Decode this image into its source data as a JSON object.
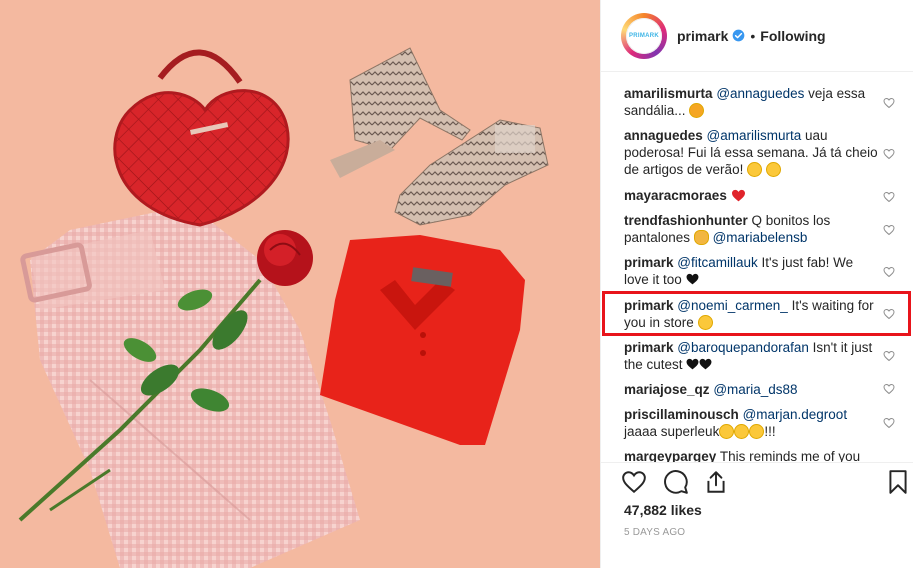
{
  "header": {
    "username": "primark",
    "avatar_text": "PRIMARK",
    "separator": "•",
    "follow_label": "Following"
  },
  "comments": [
    {
      "user": "amarilismurta",
      "mention": "@annaguedes",
      "text": " veja essa sandália...",
      "emoji": "cat"
    },
    {
      "user": "annaguedes",
      "mention": "@amarilismurta",
      "text": " uau poderosa! Fui lá essa semana. Já tá cheio de artigos de verão!",
      "emoji": "surprised, grin"
    },
    {
      "user": "mayaracmoraes",
      "mention": "",
      "text": "",
      "emoji": "red-heart"
    },
    {
      "user": "trendfashionhunter",
      "mention": "@mariabelensb",
      "text_before": " Q bonitos los pantalones ",
      "emoji": "clapping-hands"
    },
    {
      "user": "primark",
      "mention": "@fitcamillauk",
      "text": " It's just fab! We love it too ",
      "emoji": "black-heart"
    },
    {
      "user": "primark",
      "mention": "@noemi_carmen_",
      "text": " It's waiting for you in store ",
      "emoji": "wink"
    },
    {
      "user": "primark",
      "mention": "@baroquepandorafan",
      "text": " Isn't it just the cutest ",
      "emoji": "black-heart x2"
    },
    {
      "user": "mariajose_qz",
      "mention": "@maria_ds88",
      "text": "",
      "emoji": ""
    },
    {
      "user": "priscillaminousch",
      "mention": "@marjan.degroot",
      "text": " jaaaa superleuk",
      "suffix": "!!!",
      "emoji": "heart-eyes x3"
    },
    {
      "user": "margeypargey",
      "mention": "",
      "text": " This reminds me of you",
      "emoji": ""
    }
  ],
  "footer": {
    "likes": "47,882 likes",
    "time_ago": "5 DAYS AGO"
  },
  "icons": {
    "like": "heart-outline-icon",
    "comment": "comment-bubble-icon",
    "share": "share-icon",
    "save": "bookmark-icon",
    "verified": "verified-badge-icon"
  },
  "colors": {
    "accent_link": "#003569",
    "highlight_border": "#e8141b",
    "verified_blue": "#3897f0",
    "photo_background": "#f4b9a0"
  }
}
